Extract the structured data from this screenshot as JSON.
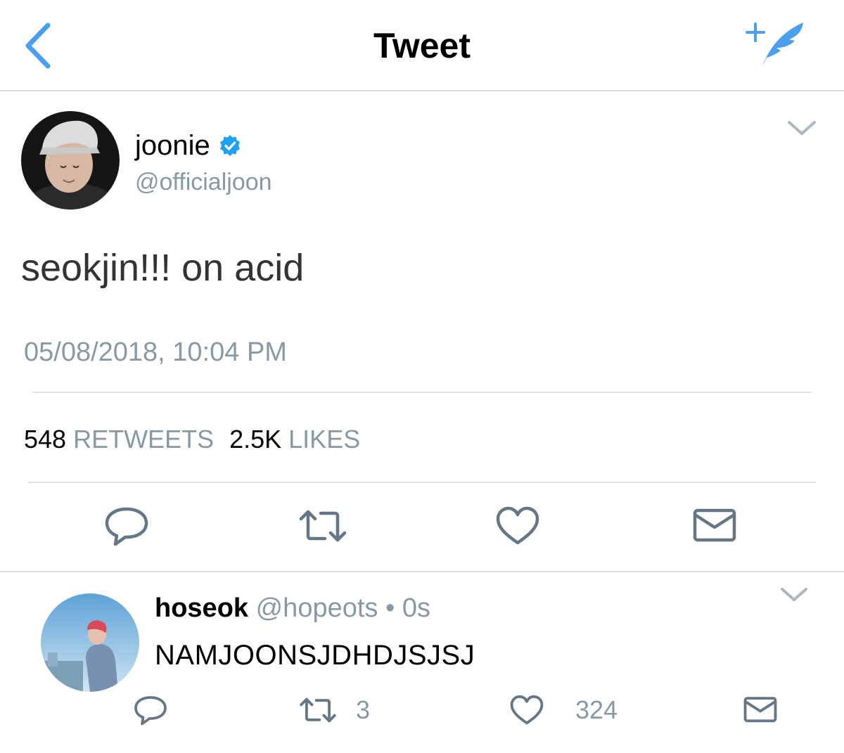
{
  "nav": {
    "title": "Tweet",
    "back_icon": "chevron-left-icon",
    "compose_icon": "compose-tweet-icon",
    "accent_color": "#4aa0ec"
  },
  "tweet": {
    "display_name": "joonie",
    "verified": true,
    "handle": "@officialjoon",
    "text": "seokjin!!! on acid",
    "timestamp": "05/08/2018, 10:04 PM",
    "retweets_count": "548",
    "retweets_label": "RETWEETS",
    "likes_count": "2.5K",
    "likes_label": "LIKES",
    "actions": [
      "reply-icon",
      "retweet-icon",
      "like-icon",
      "direct-message-icon"
    ]
  },
  "reply": {
    "display_name": "hoseok",
    "handle": "@hopeots",
    "separator": "•",
    "time": "0s",
    "text": "NAMJOONSJDHDJSJSJ",
    "retweets_count": "3",
    "likes_count": "324"
  }
}
